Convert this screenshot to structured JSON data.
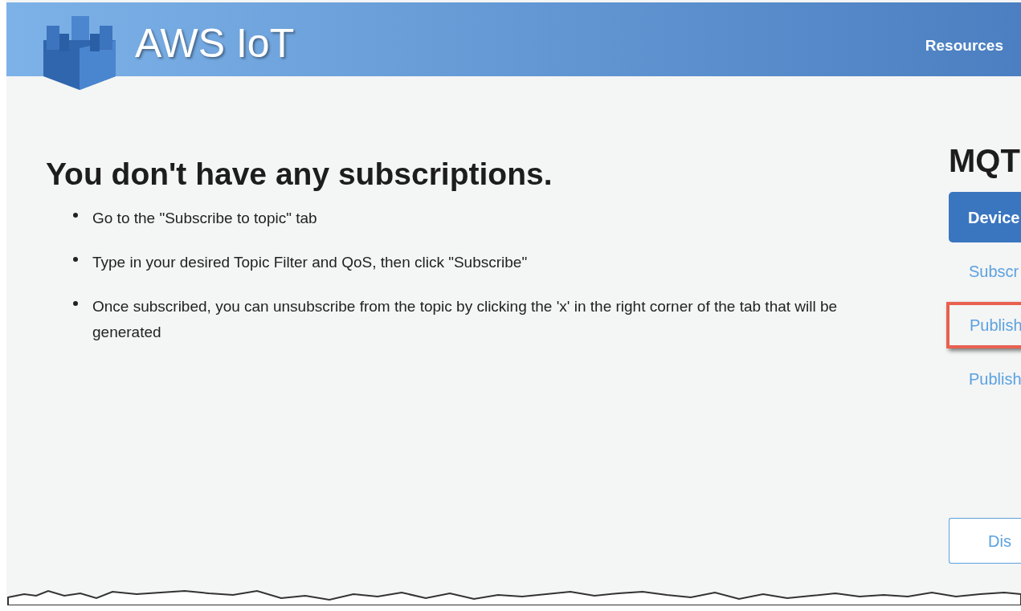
{
  "header": {
    "logo_text": "AWS IoT",
    "nav": [
      "Resources"
    ]
  },
  "empty_state": {
    "title": "You don't have any subscriptions.",
    "steps": [
      "Go to the \"Subscribe to topic\" tab",
      "Type in your desired Topic Filter and QoS, then click \"Subscribe\"",
      "Once subscribed, you can unsubscribe from the topic by clicking the 'x' in the right corner of the tab that will be generated"
    ]
  },
  "side_panel": {
    "title": "MQT",
    "items": [
      {
        "label": "Device",
        "selected": true,
        "highlighted": false
      },
      {
        "label": "Subscr",
        "selected": false,
        "highlighted": false
      },
      {
        "label": "Publish",
        "selected": false,
        "highlighted": true
      },
      {
        "label": "Publish",
        "selected": false,
        "highlighted": false
      }
    ],
    "button": "Dis"
  }
}
